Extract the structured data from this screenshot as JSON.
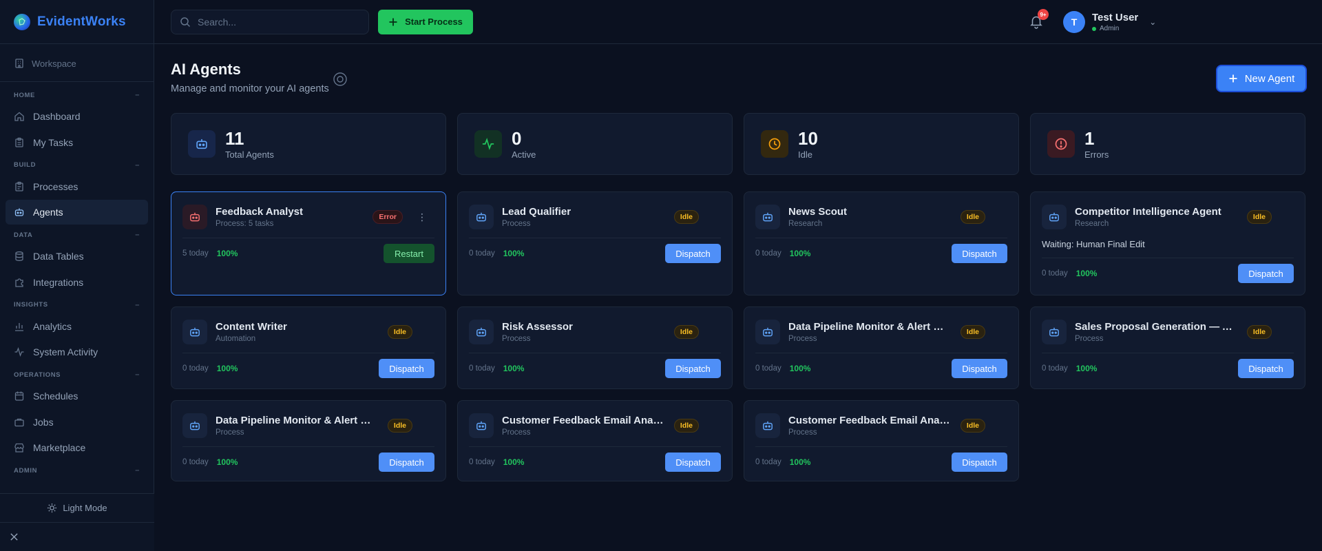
{
  "brand": {
    "name": "EvidentWorks"
  },
  "sidebar": {
    "workspace": "Workspace",
    "sections": {
      "home": "HOME",
      "build": "BUILD",
      "data": "DATA",
      "insights": "INSIGHTS",
      "operations": "OPERATIONS",
      "admin": "ADMIN"
    },
    "items": {
      "dashboard": "Dashboard",
      "my_tasks": "My Tasks",
      "processes": "Processes",
      "agents": "Agents",
      "data_tables": "Data Tables",
      "integrations": "Integrations",
      "analytics": "Analytics",
      "system_activity": "System Activity",
      "schedules": "Schedules",
      "jobs": "Jobs",
      "marketplace": "Marketplace"
    },
    "light_mode": "Light Mode"
  },
  "topbar": {
    "search_placeholder": "Search...",
    "start_process": "Start Process",
    "notifications_badge": "9+",
    "user_initial": "T",
    "user_name": "Test User",
    "user_role": "Admin"
  },
  "page": {
    "title": "AI Agents",
    "subtitle": "Manage and monitor your AI agents",
    "new_agent": "New Agent"
  },
  "stats": [
    {
      "value": "11",
      "label": "Total Agents",
      "color": "#60a5fa",
      "bg": "#17264a"
    },
    {
      "value": "0",
      "label": "Active",
      "color": "#22c55e",
      "bg": "#123124"
    },
    {
      "value": "10",
      "label": "Idle",
      "color": "#f59e0b",
      "bg": "#33280f"
    },
    {
      "value": "1",
      "label": "Errors",
      "color": "#f87171",
      "bg": "#3a1a22"
    }
  ],
  "agents": [
    {
      "name": "Feedback Analyst",
      "category": "Process: 5 tasks",
      "status": "Error",
      "today": "5 today",
      "rate": "100%",
      "action": "Restart"
    },
    {
      "name": "Lead Qualifier",
      "category": "Process",
      "status": "Idle",
      "today": "0 today",
      "rate": "100%",
      "action": "Dispatch"
    },
    {
      "name": "News Scout",
      "category": "Research",
      "status": "Idle",
      "today": "0 today",
      "rate": "100%",
      "action": "Dispatch"
    },
    {
      "name": "Competitor Intelligence Agent",
      "category": "Research",
      "status": "Idle",
      "waiting": "Waiting: Human Final Edit",
      "today": "0 today",
      "rate": "100%",
      "action": "Dispatch"
    },
    {
      "name": "Content Writer",
      "category": "Automation",
      "status": "Idle",
      "today": "0 today",
      "rate": "100%",
      "action": "Dispatch"
    },
    {
      "name": "Risk Assessor",
      "category": "Process",
      "status": "Idle",
      "today": "0 today",
      "rate": "100%",
      "action": "Dispatch"
    },
    {
      "name": "Data Pipeline Monitor & Alert — AI ...",
      "category": "Process",
      "status": "Idle",
      "today": "0 today",
      "rate": "100%",
      "action": "Dispatch"
    },
    {
      "name": "Sales Proposal Generation — AI Pr...",
      "category": "Process",
      "status": "Idle",
      "today": "0 today",
      "rate": "100%",
      "action": "Dispatch"
    },
    {
      "name": "Data Pipeline Monitor & Alert — AI ...",
      "category": "Process",
      "status": "Idle",
      "today": "0 today",
      "rate": "100%",
      "action": "Dispatch"
    },
    {
      "name": "Customer Feedback Email Analysi...",
      "category": "Process",
      "status": "Idle",
      "today": "0 today",
      "rate": "100%",
      "action": "Dispatch"
    },
    {
      "name": "Customer Feedback Email Analysi...",
      "category": "Process",
      "status": "Idle",
      "today": "0 today",
      "rate": "100%",
      "action": "Dispatch"
    }
  ]
}
